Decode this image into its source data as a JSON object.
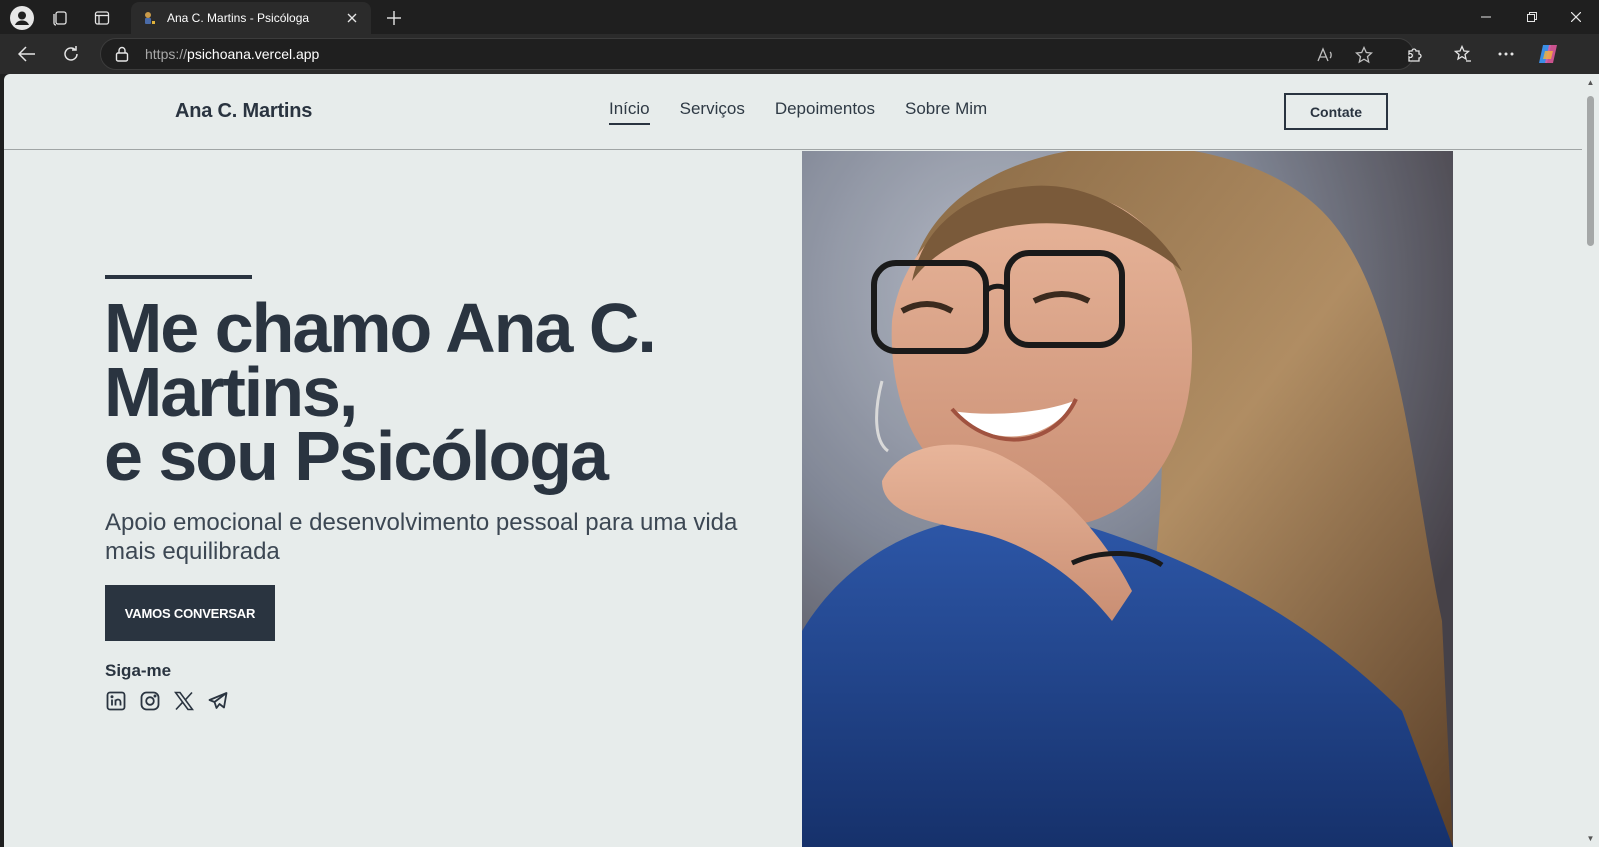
{
  "browser": {
    "tab_title": "Ana C. Martins - Psicóloga",
    "url_protocol": "https://",
    "url_host": "psichoana.vercel.app"
  },
  "site": {
    "logo": "Ana C. Martins",
    "menu": [
      {
        "label": "Início",
        "active": true
      },
      {
        "label": "Serviços",
        "active": false
      },
      {
        "label": "Depoimentos",
        "active": false
      },
      {
        "label": "Sobre Mim",
        "active": false
      }
    ],
    "contact_label": "Contate"
  },
  "hero": {
    "title_line1": "Me chamo Ana C.",
    "title_line2": "Martins,",
    "title_line3": "e sou Psicóloga",
    "subtitle": "Apoio emocional e desenvolvimento pessoal para uma vida mais equilibrada",
    "cta_label": "VAMOS CONVERSAR",
    "follow_label": "Siga-me",
    "socials": [
      "linkedin-icon",
      "instagram-icon",
      "x-icon",
      "telegram-icon"
    ]
  },
  "colors": {
    "page_bg": "#e7eceb",
    "primary": "#2a3440"
  }
}
